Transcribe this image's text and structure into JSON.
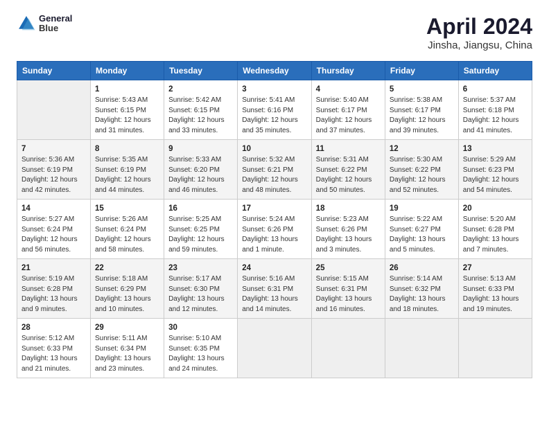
{
  "header": {
    "logo_line1": "General",
    "logo_line2": "Blue",
    "title": "April 2024",
    "subtitle": "Jinsha, Jiangsu, China"
  },
  "days_of_week": [
    "Sunday",
    "Monday",
    "Tuesday",
    "Wednesday",
    "Thursday",
    "Friday",
    "Saturday"
  ],
  "weeks": [
    [
      {
        "day": "",
        "info": ""
      },
      {
        "day": "1",
        "info": "Sunrise: 5:43 AM\nSunset: 6:15 PM\nDaylight: 12 hours\nand 31 minutes."
      },
      {
        "day": "2",
        "info": "Sunrise: 5:42 AM\nSunset: 6:15 PM\nDaylight: 12 hours\nand 33 minutes."
      },
      {
        "day": "3",
        "info": "Sunrise: 5:41 AM\nSunset: 6:16 PM\nDaylight: 12 hours\nand 35 minutes."
      },
      {
        "day": "4",
        "info": "Sunrise: 5:40 AM\nSunset: 6:17 PM\nDaylight: 12 hours\nand 37 minutes."
      },
      {
        "day": "5",
        "info": "Sunrise: 5:38 AM\nSunset: 6:17 PM\nDaylight: 12 hours\nand 39 minutes."
      },
      {
        "day": "6",
        "info": "Sunrise: 5:37 AM\nSunset: 6:18 PM\nDaylight: 12 hours\nand 41 minutes."
      }
    ],
    [
      {
        "day": "7",
        "info": "Sunrise: 5:36 AM\nSunset: 6:19 PM\nDaylight: 12 hours\nand 42 minutes."
      },
      {
        "day": "8",
        "info": "Sunrise: 5:35 AM\nSunset: 6:19 PM\nDaylight: 12 hours\nand 44 minutes."
      },
      {
        "day": "9",
        "info": "Sunrise: 5:33 AM\nSunset: 6:20 PM\nDaylight: 12 hours\nand 46 minutes."
      },
      {
        "day": "10",
        "info": "Sunrise: 5:32 AM\nSunset: 6:21 PM\nDaylight: 12 hours\nand 48 minutes."
      },
      {
        "day": "11",
        "info": "Sunrise: 5:31 AM\nSunset: 6:22 PM\nDaylight: 12 hours\nand 50 minutes."
      },
      {
        "day": "12",
        "info": "Sunrise: 5:30 AM\nSunset: 6:22 PM\nDaylight: 12 hours\nand 52 minutes."
      },
      {
        "day": "13",
        "info": "Sunrise: 5:29 AM\nSunset: 6:23 PM\nDaylight: 12 hours\nand 54 minutes."
      }
    ],
    [
      {
        "day": "14",
        "info": "Sunrise: 5:27 AM\nSunset: 6:24 PM\nDaylight: 12 hours\nand 56 minutes."
      },
      {
        "day": "15",
        "info": "Sunrise: 5:26 AM\nSunset: 6:24 PM\nDaylight: 12 hours\nand 58 minutes."
      },
      {
        "day": "16",
        "info": "Sunrise: 5:25 AM\nSunset: 6:25 PM\nDaylight: 12 hours\nand 59 minutes."
      },
      {
        "day": "17",
        "info": "Sunrise: 5:24 AM\nSunset: 6:26 PM\nDaylight: 13 hours\nand 1 minute."
      },
      {
        "day": "18",
        "info": "Sunrise: 5:23 AM\nSunset: 6:26 PM\nDaylight: 13 hours\nand 3 minutes."
      },
      {
        "day": "19",
        "info": "Sunrise: 5:22 AM\nSunset: 6:27 PM\nDaylight: 13 hours\nand 5 minutes."
      },
      {
        "day": "20",
        "info": "Sunrise: 5:20 AM\nSunset: 6:28 PM\nDaylight: 13 hours\nand 7 minutes."
      }
    ],
    [
      {
        "day": "21",
        "info": "Sunrise: 5:19 AM\nSunset: 6:28 PM\nDaylight: 13 hours\nand 9 minutes."
      },
      {
        "day": "22",
        "info": "Sunrise: 5:18 AM\nSunset: 6:29 PM\nDaylight: 13 hours\nand 10 minutes."
      },
      {
        "day": "23",
        "info": "Sunrise: 5:17 AM\nSunset: 6:30 PM\nDaylight: 13 hours\nand 12 minutes."
      },
      {
        "day": "24",
        "info": "Sunrise: 5:16 AM\nSunset: 6:31 PM\nDaylight: 13 hours\nand 14 minutes."
      },
      {
        "day": "25",
        "info": "Sunrise: 5:15 AM\nSunset: 6:31 PM\nDaylight: 13 hours\nand 16 minutes."
      },
      {
        "day": "26",
        "info": "Sunrise: 5:14 AM\nSunset: 6:32 PM\nDaylight: 13 hours\nand 18 minutes."
      },
      {
        "day": "27",
        "info": "Sunrise: 5:13 AM\nSunset: 6:33 PM\nDaylight: 13 hours\nand 19 minutes."
      }
    ],
    [
      {
        "day": "28",
        "info": "Sunrise: 5:12 AM\nSunset: 6:33 PM\nDaylight: 13 hours\nand 21 minutes."
      },
      {
        "day": "29",
        "info": "Sunrise: 5:11 AM\nSunset: 6:34 PM\nDaylight: 13 hours\nand 23 minutes."
      },
      {
        "day": "30",
        "info": "Sunrise: 5:10 AM\nSunset: 6:35 PM\nDaylight: 13 hours\nand 24 minutes."
      },
      {
        "day": "",
        "info": ""
      },
      {
        "day": "",
        "info": ""
      },
      {
        "day": "",
        "info": ""
      },
      {
        "day": "",
        "info": ""
      }
    ]
  ]
}
